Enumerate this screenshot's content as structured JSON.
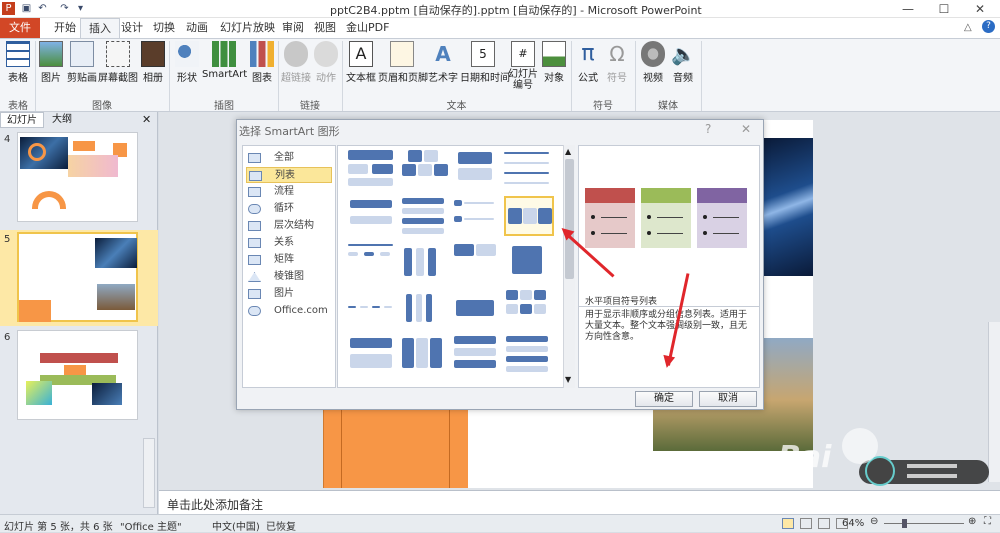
{
  "window": {
    "title": "pptC2B4.pptm [自动保存的].pptm [自动保存的] - Microsoft PowerPoint"
  },
  "tabs": [
    "文件",
    "开始",
    "插入",
    "设计",
    "切换",
    "动画",
    "幻灯片放映",
    "审阅",
    "视图",
    "金山PDF"
  ],
  "ribbon": {
    "buttons": [
      "表格",
      "图片",
      "剪贴画",
      "屏幕截图",
      "相册",
      "形状",
      "SmartArt",
      "图表",
      "超链接",
      "动作",
      "文本框",
      "页眉和页脚",
      "艺术字",
      "日期和时间",
      "幻灯片编号",
      "对象",
      "公式",
      "符号",
      "视频",
      "音频"
    ],
    "groups": [
      "表格",
      "图像",
      "插图",
      "链接",
      "文本",
      "符号",
      "媒体"
    ]
  },
  "leftpane": {
    "tabs": [
      "幻灯片",
      "大纲"
    ],
    "slide_numbers": [
      "4",
      "5",
      "6"
    ]
  },
  "dialog": {
    "title": "选择 SmartArt 图形",
    "categories": [
      "全部",
      "列表",
      "流程",
      "循环",
      "层次结构",
      "关系",
      "矩阵",
      "棱锥图",
      "图片",
      "Office.com"
    ],
    "selected_category": "列表",
    "preview_title": "水平项目符号列表",
    "preview_desc": "用于显示非顺序或分组信息列表。适用于大量文本。整个文本强调级别一致，且无方向性含意。",
    "ok": "确定",
    "cancel": "取消"
  },
  "notes": {
    "placeholder": "单击此处添加备注"
  },
  "status": {
    "slide_info": "幻灯片 第 5 张，共 6 张",
    "theme": "\"Office 主题\"",
    "language": "中文(中国)",
    "recovered": "已恢复",
    "zoom": "64%"
  },
  "colors": {
    "file_tab": "#d24726",
    "preview_red": "#c0504d",
    "preview_green": "#9bbb59",
    "preview_purple": "#8064a2",
    "arrow": "#e0262b",
    "slide_orange": "#f79646"
  }
}
